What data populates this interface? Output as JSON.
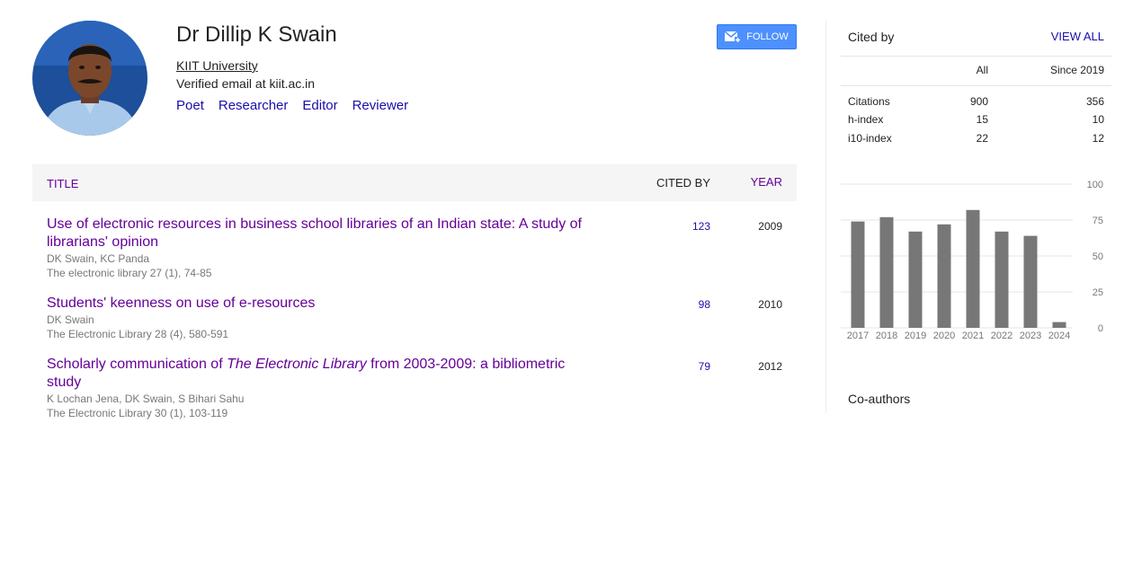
{
  "profile": {
    "name": "Dr Dillip K Swain",
    "affiliation": "KIIT University",
    "email": "Verified email at kiit.ac.in",
    "interests": [
      "Poet",
      "Researcher",
      "Editor",
      "Reviewer"
    ],
    "follow_label": "FOLLOW"
  },
  "table": {
    "col_title": "TITLE",
    "col_cited": "CITED BY",
    "col_year": "YEAR",
    "rows": [
      {
        "title": "Use of electronic resources in business school libraries of an Indian state: A study of librarians' opinion",
        "authors": "DK Swain, KC Panda",
        "venue": "The electronic library 27 (1), 74-85",
        "cited": "123",
        "year": "2009"
      },
      {
        "title": "Students' keenness on use of e-resources",
        "authors": "DK Swain",
        "venue": "The Electronic Library 28 (4), 580-591",
        "cited": "98",
        "year": "2010"
      },
      {
        "title_pre": "Scholarly communication of ",
        "title_em": "The Electronic Library",
        "title_post": " from 2003-2009: a bibliometric study",
        "authors": "K Lochan Jena, DK Swain, S Bihari Sahu",
        "venue": "The Electronic Library 30 (1), 103-119",
        "cited": "79",
        "year": "2012"
      }
    ]
  },
  "cited_by": {
    "title": "Cited by",
    "view_all": "VIEW ALL",
    "col_all": "All",
    "col_since": "Since 2019",
    "stats": [
      {
        "label": "Citations",
        "all": "900",
        "since": "356"
      },
      {
        "label": "h-index",
        "all": "15",
        "since": "10"
      },
      {
        "label": "i10-index",
        "all": "22",
        "since": "12"
      }
    ]
  },
  "chart_data": {
    "type": "bar",
    "categories": [
      "2017",
      "2018",
      "2019",
      "2020",
      "2021",
      "2022",
      "2023",
      "2024"
    ],
    "values": [
      74,
      77,
      67,
      72,
      82,
      67,
      64,
      4
    ],
    "ylim": [
      0,
      100
    ],
    "yticks": [
      "100",
      "75",
      "50",
      "25",
      "0"
    ],
    "grid": true
  },
  "coauthors": {
    "title": "Co-authors"
  }
}
